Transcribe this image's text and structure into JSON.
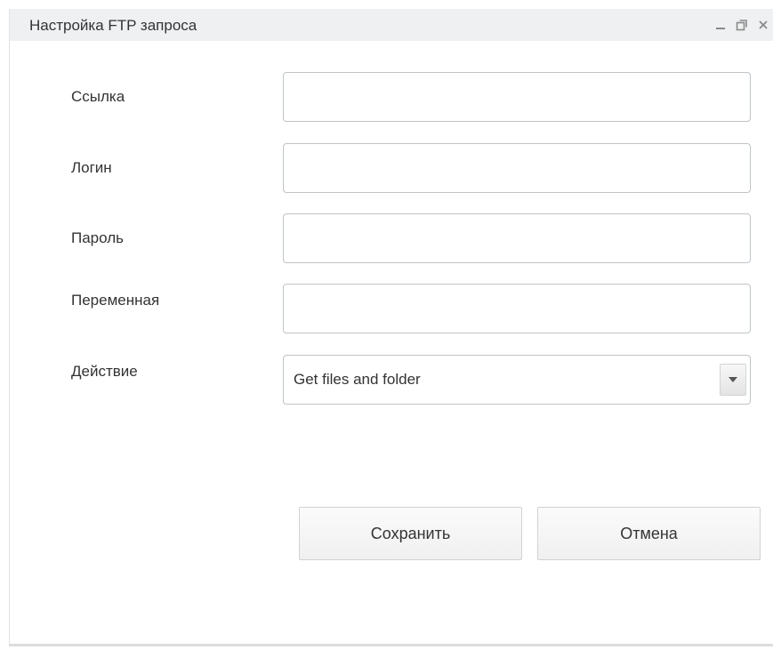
{
  "window": {
    "title": "Настройка FTP запроса"
  },
  "title_controls": {
    "minimize_icon": "minimize-icon",
    "restore_icon": "restore-icon",
    "close_icon": "close-icon"
  },
  "form": {
    "link": {
      "label": "Ссылка",
      "value": ""
    },
    "login": {
      "label": "Логин",
      "value": ""
    },
    "password": {
      "label": "Пароль",
      "value": ""
    },
    "variable": {
      "label": "Переменная",
      "value": ""
    },
    "action": {
      "label": "Действие",
      "selected": "Get files and folder"
    }
  },
  "buttons": {
    "save_label": "Сохранить",
    "cancel_label": "Отмена"
  }
}
